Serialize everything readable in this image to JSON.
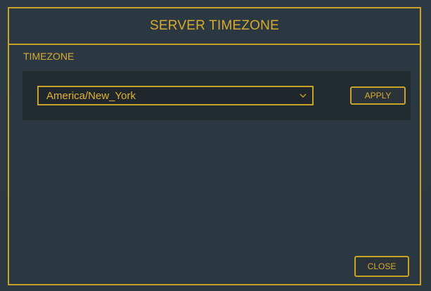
{
  "modal": {
    "title": "SERVER TIMEZONE"
  },
  "timezone": {
    "label": "TIMEZONE",
    "selected_value": "America/New_York",
    "apply_label": "APPLY"
  },
  "footer": {
    "close_label": "CLOSE"
  },
  "icons": {
    "dropdown": "chevron-down-icon"
  },
  "colors": {
    "accent": "#c9a227",
    "text_accent": "#d8aa2e",
    "modal_bg": "#2b3842",
    "panel_bg": "#222b30"
  }
}
